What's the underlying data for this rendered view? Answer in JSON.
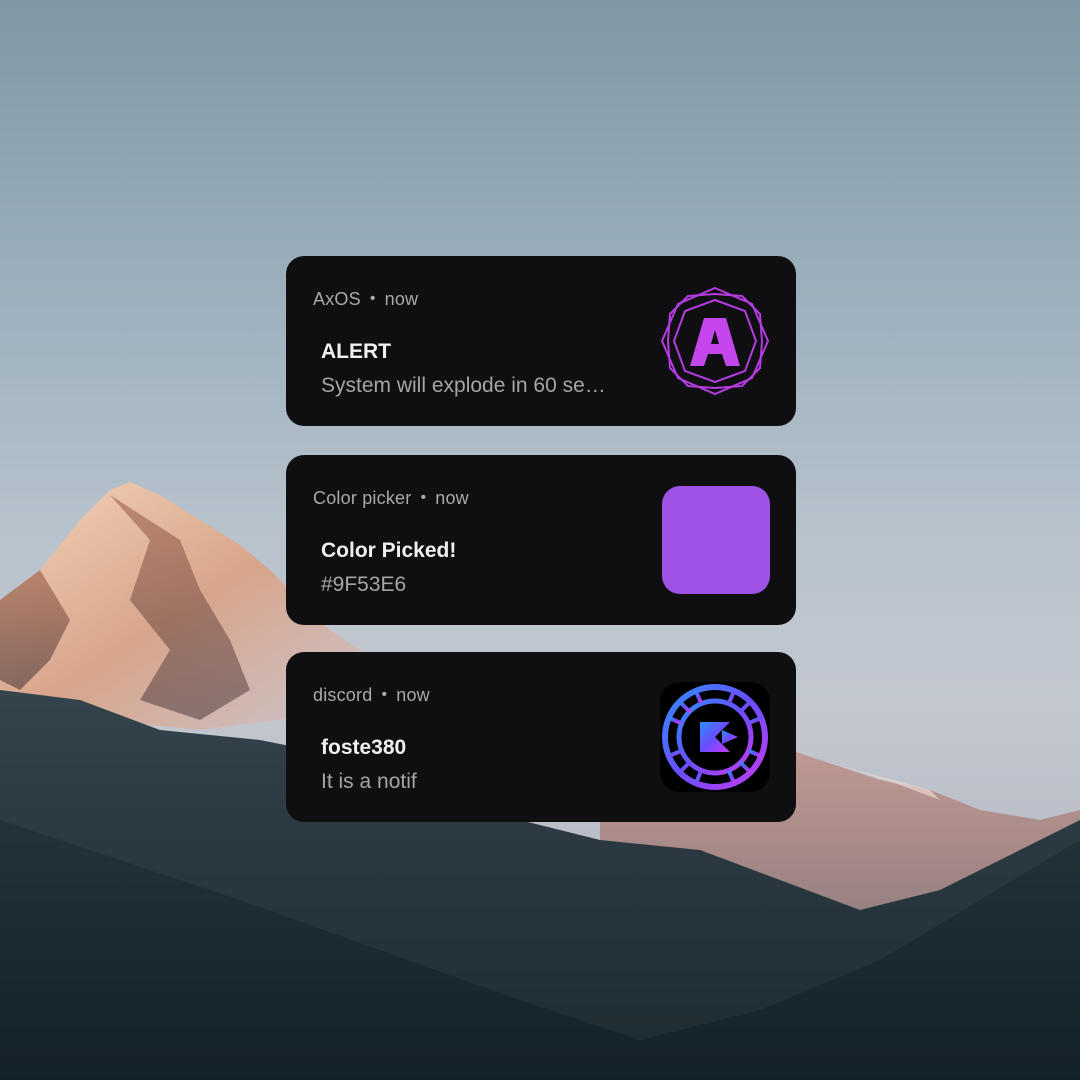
{
  "notifications": [
    {
      "app": "AxOS",
      "time": "now",
      "title": "ALERT",
      "body": "System will explode in 60 se…",
      "icon": "axos-logo-icon",
      "icon_color": "#b43be0"
    },
    {
      "app": "Color picker",
      "time": "now",
      "title": "Color Picked!",
      "body": "#9F53E6",
      "icon": "color-swatch",
      "swatch_color": "#9f53e6"
    },
    {
      "app": "discord",
      "time": "now",
      "title": "foste380",
      "body": "It is a notif",
      "icon": "discord-avatar-icon"
    }
  ],
  "separator": "•",
  "colors": {
    "card_bg": "#0f0f12",
    "meta_text": "#a9a9ad",
    "title_text": "#f0f0f0",
    "body_text": "#a5a5a9"
  }
}
